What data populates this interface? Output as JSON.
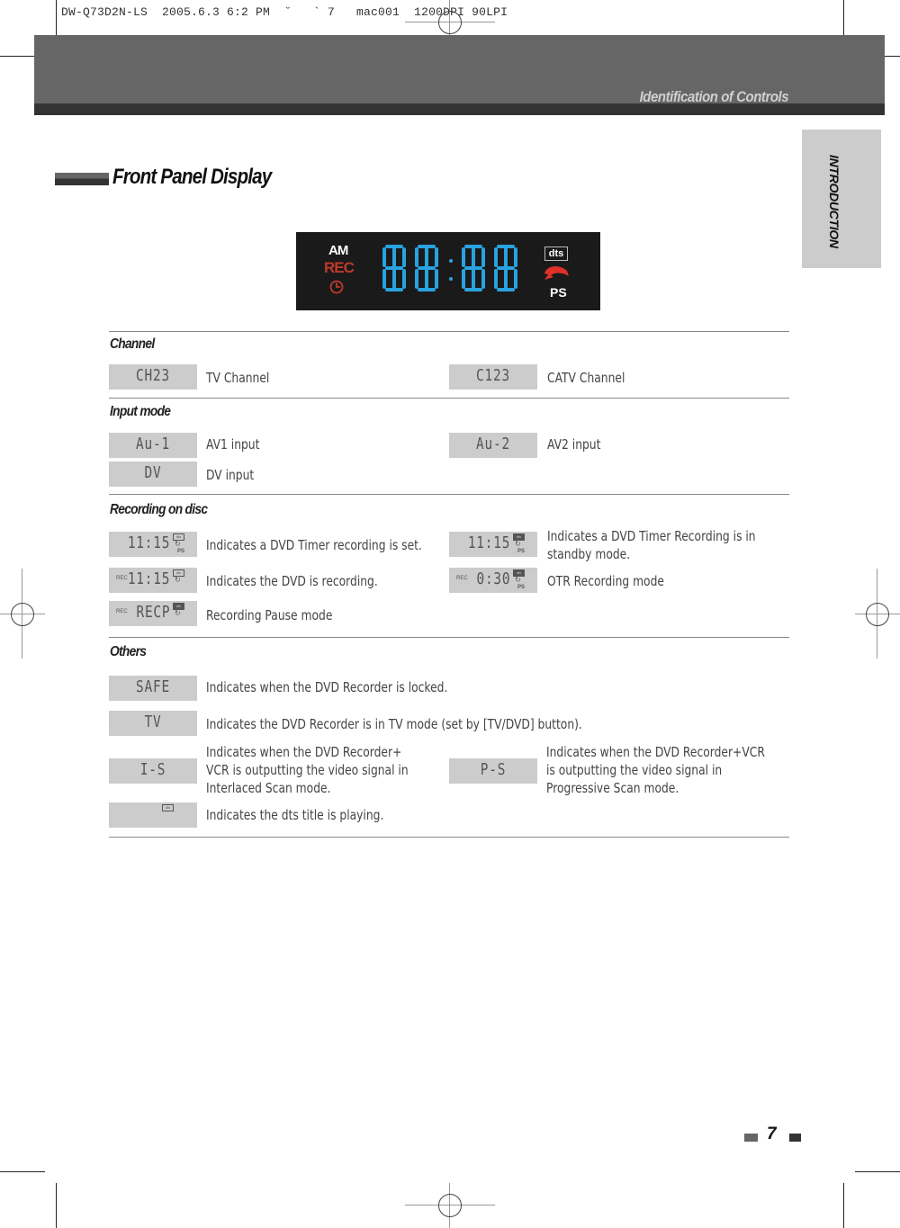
{
  "print_slug": "DW-Q73D2N-LS  2005.6.3 6:2 PM  ˘   ` 7   mac001  1200DPI 90LPI",
  "header": {
    "title": "Identification of Controls"
  },
  "side_tab": {
    "label": "INTRODUCTION"
  },
  "section": {
    "title": "Front Panel Display"
  },
  "front_panel": {
    "am_label": "AM",
    "rec_label": "REC",
    "clock_icon": "timer-clock-icon",
    "digits": "88:88",
    "dts_label": "dts",
    "disc_icon": "disc-arrow-icon",
    "ps_label": "PS",
    "colors": {
      "background": "#1a1a1a",
      "digits": "#29a3e0",
      "rec": "#c0392b",
      "disc": "#e0302a"
    }
  },
  "categories": [
    {
      "title": "Channel",
      "items": [
        {
          "display": "CH23",
          "description": "TV Channel"
        },
        {
          "display": "C123",
          "description": "CATV Channel"
        }
      ]
    },
    {
      "title": "Input mode",
      "items": [
        {
          "display": "Au-1",
          "description": "AV1 input"
        },
        {
          "display": "Au-2",
          "description": "AV2 input"
        },
        {
          "display": "DV",
          "description": "DV input"
        }
      ]
    },
    {
      "title": "Recording on disc",
      "items": [
        {
          "display": "11:15",
          "rec": "",
          "dts": "dts",
          "ps": "PS",
          "description": "Indicates a DVD Timer recording is set."
        },
        {
          "display": "11:15",
          "rec": "",
          "dts": "dts",
          "ps": "PS",
          "description_lines": [
            "Indicates a DVD Timer Recording is in",
            "standby mode."
          ]
        },
        {
          "display": "11:15",
          "rec": "REC",
          "dts": "dts",
          "ps": "",
          "description": "Indicates the DVD is recording."
        },
        {
          "display": "0:30",
          "rec": "REC",
          "dts": "dts",
          "ps": "PS",
          "description": "OTR Recording mode"
        },
        {
          "display": "RECP",
          "rec": "REC",
          "dts": "dts",
          "ps": "",
          "description": "Recording Pause mode"
        }
      ]
    },
    {
      "title": "Others",
      "items": [
        {
          "display": "SAFE",
          "description": "Indicates when the DVD Recorder is locked."
        },
        {
          "display": "TV",
          "description": "Indicates the DVD Recorder is in TV mode (set by [TV/DVD] button)."
        },
        {
          "display": "I-S",
          "description_lines": [
            "Indicates when the DVD Recorder+",
            "VCR is outputting the video signal in",
            "Interlaced Scan mode."
          ]
        },
        {
          "display": "P-S",
          "description_lines": [
            "Indicates when the DVD Recorder+VCR",
            "is outputting the video signal in",
            "Progressive Scan mode."
          ]
        },
        {
          "display": "",
          "dts": "dts",
          "description": "Indicates the dts title is playing."
        }
      ]
    }
  ],
  "page_number": "7"
}
